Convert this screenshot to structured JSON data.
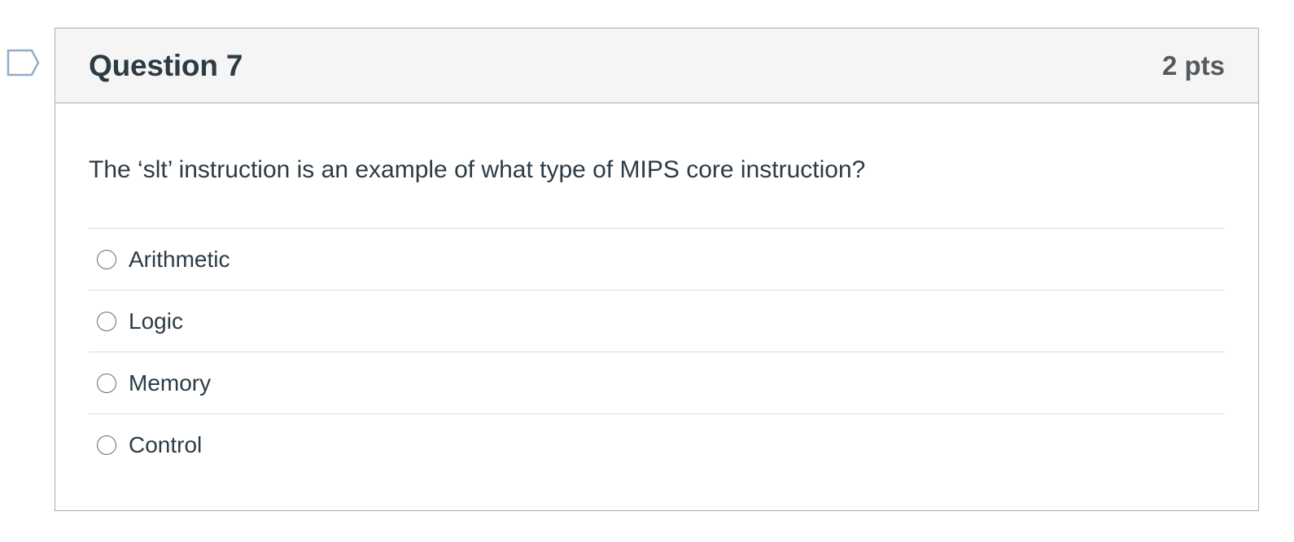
{
  "question": {
    "title": "Question 7",
    "points": "2 pts",
    "text": "The ‘slt’ instruction is an example of what type of MIPS core instruction?",
    "answers": [
      {
        "label": "Arithmetic",
        "selected": false
      },
      {
        "label": "Logic",
        "selected": false
      },
      {
        "label": "Memory",
        "selected": false
      },
      {
        "label": "Control",
        "selected": false
      }
    ]
  },
  "icons": {
    "flag": "flag-question-icon"
  },
  "colors": {
    "header_bg": "#f5f5f5",
    "border": "#a9aeb1",
    "text": "#2d3b45",
    "flag_outline": "#8faec8"
  }
}
